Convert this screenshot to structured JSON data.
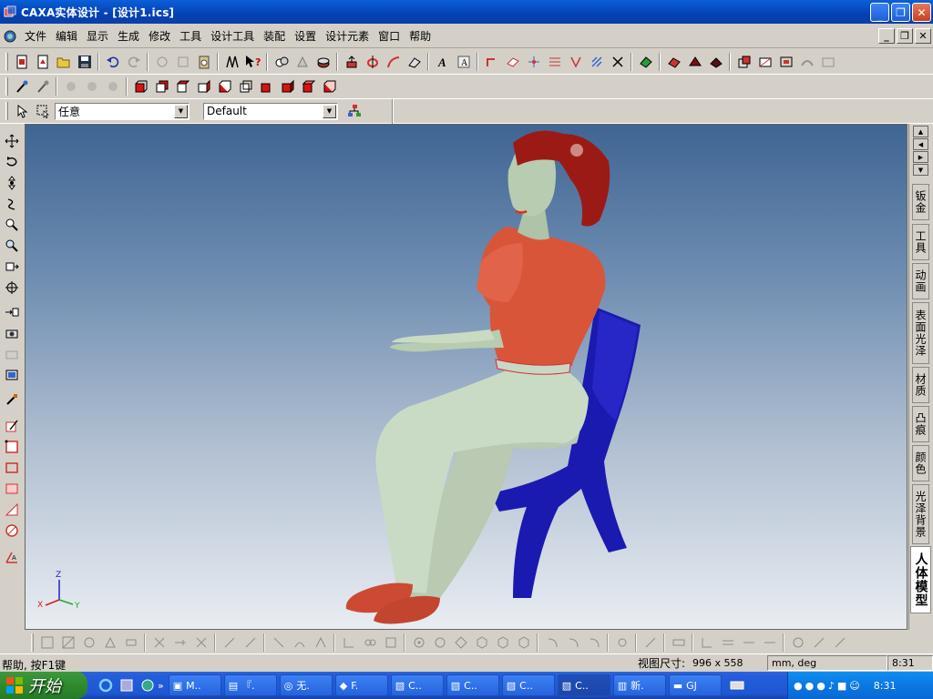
{
  "window": {
    "title": "CAXA实体设计 - [设计1.ics]"
  },
  "menu": [
    "文件",
    "编辑",
    "显示",
    "生成",
    "修改",
    "工具",
    "设计工具",
    "装配",
    "设置",
    "设计元素",
    "窗口",
    "帮助"
  ],
  "toolbar3": {
    "filter_value": "任意",
    "config_value": "Default"
  },
  "right_tabs": [
    "钣金",
    "工具",
    "动画",
    "表面光泽",
    "材质",
    "凸痕",
    "颜色",
    "光泽背景",
    "人体模型"
  ],
  "triad": {
    "z": "Z",
    "x": "X",
    "y": "Y"
  },
  "status": {
    "help": "帮助, 按F1键",
    "view_size_label": "视图尺寸:",
    "view_size": "996 x 558",
    "units": "mm, deg",
    "time": "8:31"
  },
  "taskbar": {
    "start_label": "开始",
    "tasks": [
      "M..",
      "『.",
      "无.",
      "F.",
      "C..",
      "C..",
      "C..",
      "C..",
      "新.",
      "GJ"
    ],
    "clock": "8:31"
  },
  "colors": {
    "shirt": "#d9553a",
    "pants": "#c9d8c4",
    "skin": "#b7ccb0",
    "hair": "#9c1a16",
    "chair": "#1a1ab0",
    "shoes": "#cc4a33"
  }
}
